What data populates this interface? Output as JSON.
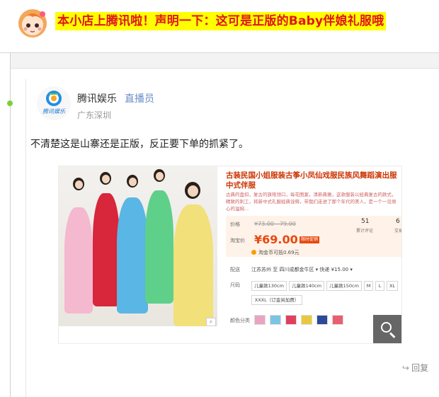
{
  "caption": "本小店上腾讯啦！声明一下：这可是正版的Baby伴娘礼服哦",
  "post": {
    "author_name": "腾讯娱乐",
    "author_role": "直播员",
    "location": "广东深圳",
    "logo_text": "腾讯娱乐",
    "text": "不清楚这是山寨还是正版，反正要下单的抓紧了。",
    "reply_label": "回复"
  },
  "product": {
    "title": "古装民国小姐服装古筝小凤仙戏服民族风舞蹈演出服中式伴服",
    "description": "古典的盘扣，复古的旗袍领口，每花图案，清新典雅，这款服装以经典复古的款式，精致的刺工，将新中式礼服经典诠释，带我们走进了那个年代的美人，是一个一见倾心的温婉...",
    "price_label": "价格",
    "original_price": "¥73.00 - 79.00",
    "sold_count": "51",
    "sold_label": "累计评论",
    "sold_count_2": "6",
    "sold_label_2": "交易",
    "taobao_price_label": "淘宝价",
    "price": "¥69.00",
    "promo": "限时促销",
    "coin_text": "淘金币可抵0.69元",
    "shipping_label": "配送",
    "shipping_text": "江苏苏州 至  四川成都金牛区 ▾  快递 ¥15.00 ▾",
    "size_label": "尺码",
    "sizes": [
      "儿童款130cm",
      "儿童款140cm",
      "儿童款150cm",
      "M",
      "L",
      "XL",
      "XXXL（订金另加费）"
    ],
    "color_label": "颜色分类",
    "swatch_colors": [
      "#e8a4c0",
      "#7bc4e4",
      "#e04060",
      "#e8c840",
      "#2c4a9a",
      "#e86070"
    ],
    "model_colors": [
      "#f4b8cf",
      "#d8263a",
      "#5ab6e4",
      "#5fd08a",
      "#f2e07a"
    ]
  }
}
